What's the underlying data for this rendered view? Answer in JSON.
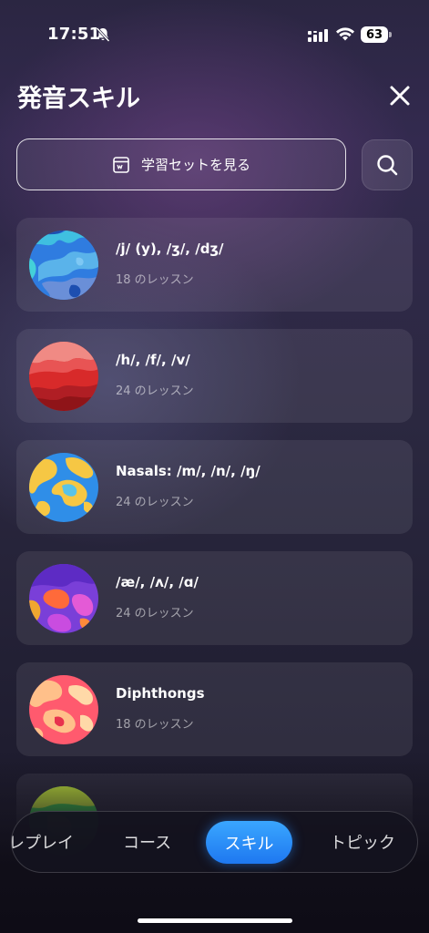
{
  "status_bar": {
    "time": "17:51",
    "battery": "63",
    "icons": [
      "bell-slash-icon",
      "signal-icon",
      "wifi-icon",
      "battery-icon"
    ]
  },
  "header": {
    "title": "発音スキル",
    "close_icon": "close-icon"
  },
  "actions": {
    "study_set_label": "学習セットを見る",
    "study_set_icon": "flashcard-icon",
    "search_icon": "search-icon"
  },
  "skills": [
    {
      "name": "/j/ (y), /ʒ/, /dʒ/",
      "lessons": "18 のレッスン",
      "planet": "blue-planet-icon"
    },
    {
      "name": "/h/, /f/, /v/",
      "lessons": "24 のレッスン",
      "planet": "red-planet-icon"
    },
    {
      "name": "Nasals: /m/, /n/, /ŋ/",
      "lessons": "24 のレッスン",
      "planet": "earth-planet-icon"
    },
    {
      "name": "/æ/, /ʌ/, /ɑ/",
      "lessons": "24 のレッスン",
      "planet": "purple-planet-icon"
    },
    {
      "name": "Diphthongs",
      "lessons": "18 のレッスン",
      "planet": "pink-planet-icon"
    }
  ],
  "tabs": {
    "replay": "レプレイ",
    "course": "コース",
    "skill": "スキル",
    "topic": "トピック",
    "active": "skill"
  },
  "colors": {
    "accent": "#2a8cff",
    "background": "#2b2642"
  }
}
